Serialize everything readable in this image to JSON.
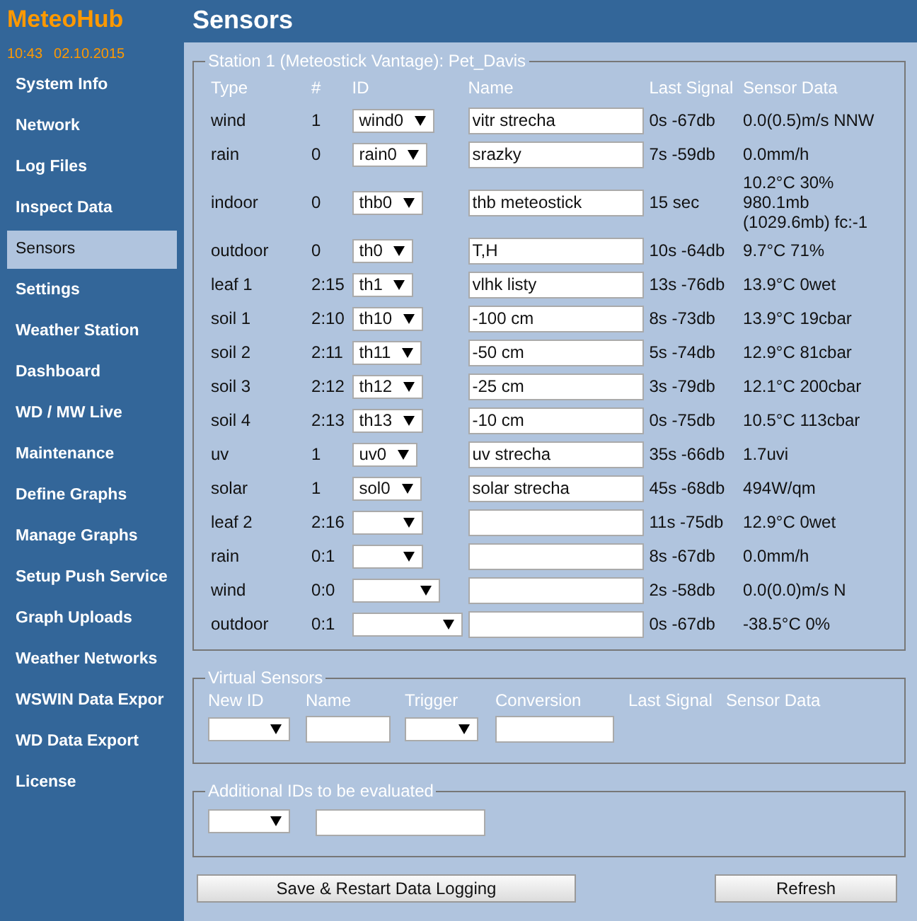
{
  "app": {
    "title": "MeteoHub",
    "time": "10:43",
    "date": "02.10.2015"
  },
  "sidebar": {
    "items": [
      {
        "label": "System Info",
        "selected": false
      },
      {
        "label": "Network",
        "selected": false
      },
      {
        "label": "Log Files",
        "selected": false
      },
      {
        "label": "Inspect Data",
        "selected": false
      },
      {
        "label": "Sensors",
        "selected": true
      },
      {
        "label": "Settings",
        "selected": false
      },
      {
        "label": "Weather Station",
        "selected": false
      },
      {
        "label": "Dashboard",
        "selected": false
      },
      {
        "label": "WD / MW Live",
        "selected": false
      },
      {
        "label": "Maintenance",
        "selected": false
      },
      {
        "label": "Define Graphs",
        "selected": false
      },
      {
        "label": "Manage Graphs",
        "selected": false
      },
      {
        "label": "Setup Push Service",
        "selected": false
      },
      {
        "label": "Graph Uploads",
        "selected": false
      },
      {
        "label": "Weather Networks",
        "selected": false
      },
      {
        "label": "WSWIN Data Expor",
        "selected": false
      },
      {
        "label": "WD Data Export",
        "selected": false
      },
      {
        "label": "License",
        "selected": false
      }
    ]
  },
  "page": {
    "title": "Sensors"
  },
  "station": {
    "legend": "Station 1 (Meteostick Vantage): Pet_Davis",
    "columns": [
      "Type",
      "#",
      "ID",
      "Name",
      "Last Signal",
      "Sensor Data"
    ],
    "rows": [
      {
        "type": "wind",
        "number": "1",
        "id": "wind0",
        "name": "vitr strecha",
        "last_signal": "0s -67db",
        "sensor_data": "0.0(0.5)m/s NNW"
      },
      {
        "type": "rain",
        "number": "0",
        "id": "rain0",
        "name": "srazky",
        "last_signal": "7s -59db",
        "sensor_data": "0.0mm/h"
      },
      {
        "type": "indoor",
        "number": "0",
        "id": "thb0",
        "name": "thb meteostick",
        "last_signal": "15 sec",
        "sensor_data": "10.2°C 30% 980.1mb (1029.6mb) fc:-1"
      },
      {
        "type": "outdoor",
        "number": "0",
        "id": "th0",
        "name": "T,H",
        "last_signal": "10s -64db",
        "sensor_data": "9.7°C 71%"
      },
      {
        "type": "leaf 1",
        "number": "2:15",
        "id": "th1",
        "name": "vlhk listy",
        "last_signal": "13s -76db",
        "sensor_data": "13.9°C 0wet"
      },
      {
        "type": "soil 1",
        "number": "2:10",
        "id": "th10",
        "name": "-100 cm",
        "last_signal": "8s -73db",
        "sensor_data": "13.9°C 19cbar"
      },
      {
        "type": "soil 2",
        "number": "2:11",
        "id": "th11",
        "name": "-50 cm",
        "last_signal": "5s -74db",
        "sensor_data": "12.9°C 81cbar"
      },
      {
        "type": "soil 3",
        "number": "2:12",
        "id": "th12",
        "name": "-25 cm",
        "last_signal": "3s -79db",
        "sensor_data": "12.1°C 200cbar"
      },
      {
        "type": "soil 4",
        "number": "2:13",
        "id": "th13",
        "name": "-10 cm",
        "last_signal": "0s -75db",
        "sensor_data": "10.5°C 113cbar"
      },
      {
        "type": "uv",
        "number": "1",
        "id": "uv0",
        "name": "uv strecha",
        "last_signal": "35s -66db",
        "sensor_data": "1.7uvi"
      },
      {
        "type": "solar",
        "number": "1",
        "id": "sol0",
        "name": "solar strecha",
        "last_signal": "45s -68db",
        "sensor_data": "494W/qm"
      },
      {
        "type": "leaf 2",
        "number": "2:16",
        "last_signal": "11s -75db",
        "sensor_data": "12.9°C 0wet"
      },
      {
        "type": "rain",
        "number": "0:1",
        "last_signal": "8s -67db",
        "sensor_data": "0.0mm/h"
      },
      {
        "type": "wind",
        "number": "0:0",
        "last_signal": "2s -58db",
        "sensor_data": "0.0(0.0)m/s N"
      },
      {
        "type": "outdoor",
        "number": "0:1",
        "last_signal": "0s -67db",
        "sensor_data": "-38.5°C 0%"
      }
    ]
  },
  "virtual_sensors": {
    "legend": "Virtual Sensors",
    "columns": [
      "New ID",
      "Name",
      "Trigger",
      "Conversion",
      "Last Signal",
      "Sensor Data"
    ]
  },
  "additional_ids": {
    "legend": "Additional IDs to be evaluated"
  },
  "buttons": [
    "Save & Restart Data Logging",
    "Refresh"
  ]
}
